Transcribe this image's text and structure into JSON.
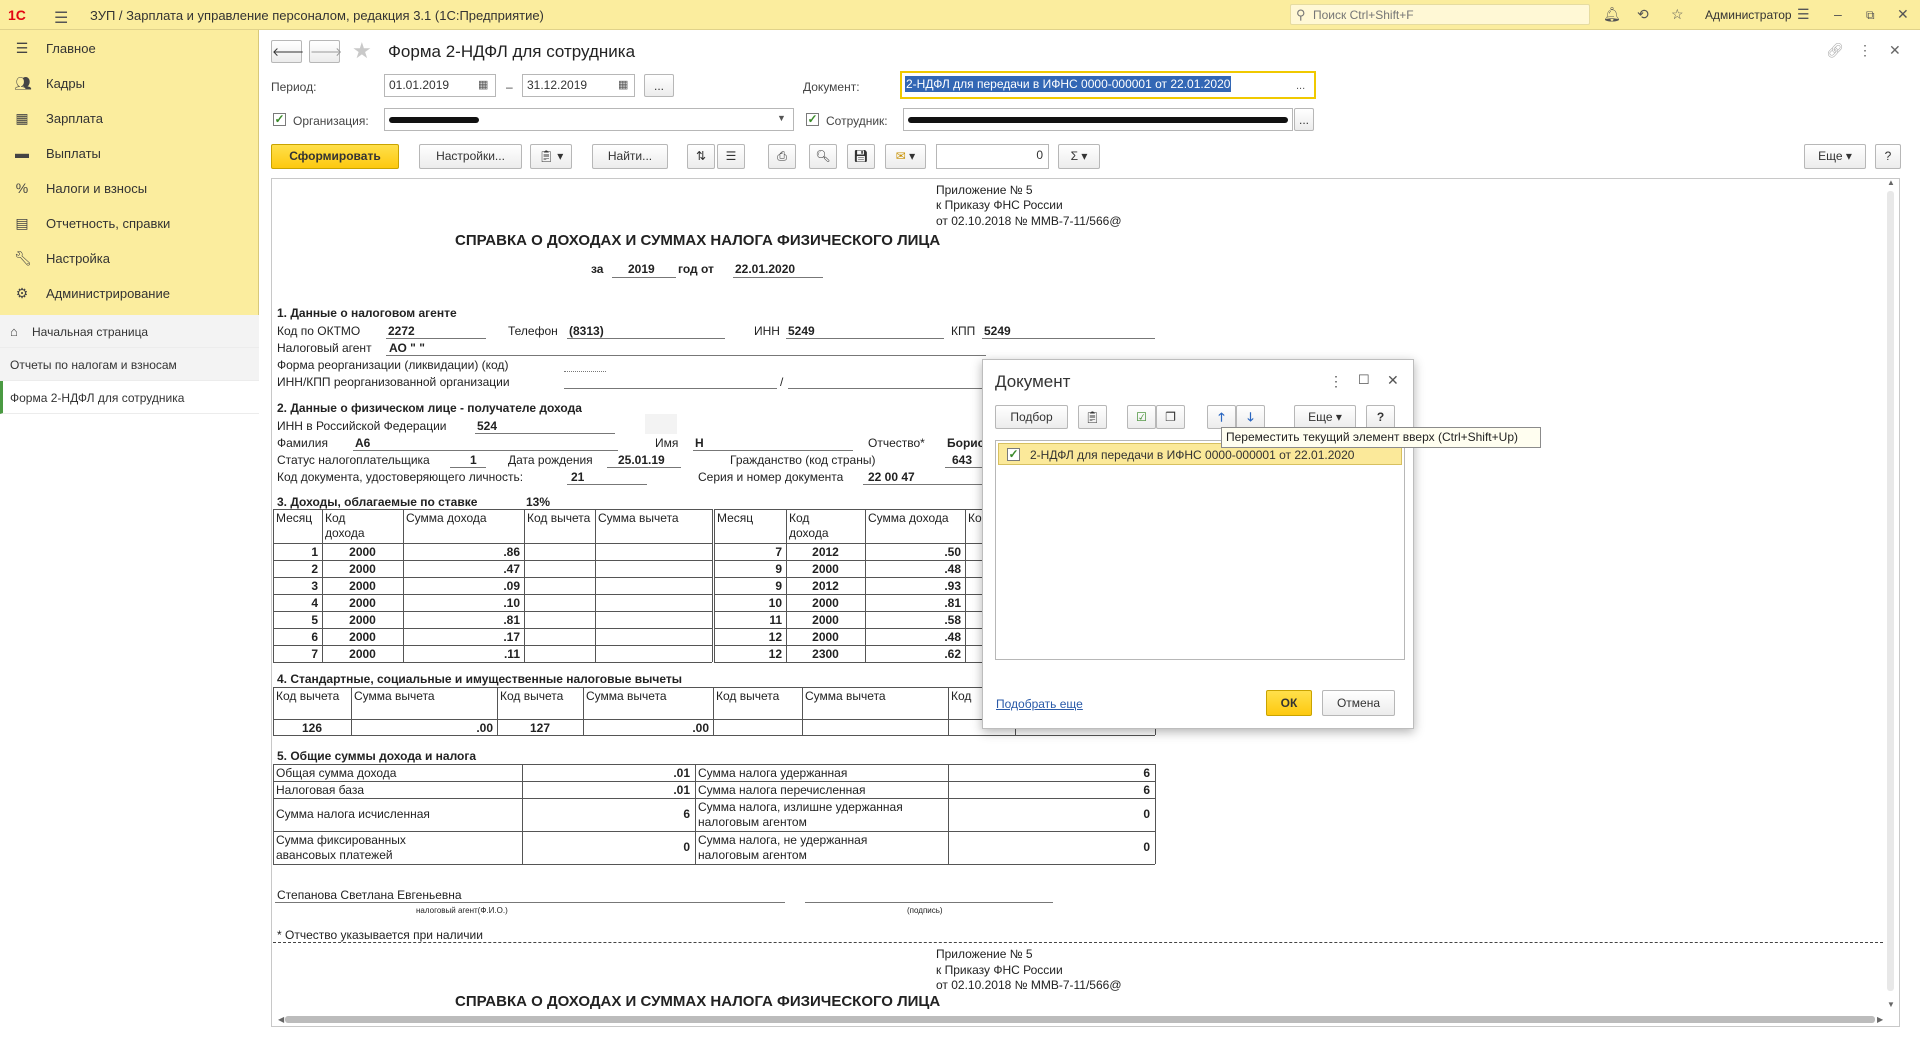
{
  "titlebar": {
    "logo": "1С",
    "app_title": "ЗУП / Зарплата и управление персоналом, редакция 3.1  (1С:Предприятие)",
    "search_placeholder": "Поиск Ctrl+Shift+F",
    "user": "Администратор"
  },
  "sidebar": {
    "items": [
      {
        "icon": "menu-lines-icon",
        "label": "Главное"
      },
      {
        "icon": "people-icon",
        "label": "Кадры"
      },
      {
        "icon": "calculator-icon",
        "label": "Зарплата"
      },
      {
        "icon": "wallet-icon",
        "label": "Выплаты"
      },
      {
        "icon": "percent-icon",
        "label": "Налоги и взносы"
      },
      {
        "icon": "reports-icon",
        "label": "Отчетность, справки"
      },
      {
        "icon": "wrench-icon",
        "label": "Настройка"
      },
      {
        "icon": "gear-icon",
        "label": "Администрирование"
      }
    ],
    "links": [
      {
        "label": "Начальная страница"
      },
      {
        "label": "Отчеты по налогам и взносам"
      },
      {
        "label": "Форма 2-НДФЛ для сотрудника"
      }
    ]
  },
  "form": {
    "title": "Форма 2-НДФЛ для сотрудника",
    "period_label": "Период:",
    "period_from": "01.01.2019",
    "period_dash": "–",
    "period_to": "31.12.2019",
    "ellipsis": "...",
    "document_label": "Документ:",
    "document_value": "2-НДФЛ для передачи в ИФНС 0000-000001 от 22.01.2020",
    "org_label": "Организация:",
    "employee_label": "Сотрудник:",
    "btn_generate": "Сформировать",
    "btn_settings": "Настройки...",
    "btn_find": "Найти...",
    "sum_value": "0",
    "btn_more": "Еще",
    "btn_help": "?"
  },
  "report": {
    "appendix": [
      "Приложение № 5",
      "к Приказу ФНС России",
      "от 02.10.2018 № ММВ-7-11/566@"
    ],
    "title": "СПРАВКА О ДОХОДАХ И СУММАХ НАЛОГА ФИЗИЧЕСКОГО ЛИЦА",
    "for_label": "за",
    "year": "2019",
    "year_from_label": "год от",
    "date": "22.01.2020",
    "s1_title": "1. Данные о налоговом агенте",
    "oktmo_label": "Код по ОКТМО",
    "oktmo": "2272",
    "phone_label": "Телефон",
    "phone": "(8313)",
    "inn_label": "ИНН",
    "inn": "5249",
    "kpp_label": "КПП",
    "kpp": "5249",
    "agent_label": "Налоговый агент",
    "agent": "АО \"                \"",
    "reorg_label": "Форма реорганизации (ликвидации)  (код)",
    "reorg_inn_label": "ИНН/КПП  реорганизованной организации",
    "slash": "/",
    "s2_title": "2. Данные о физическом лице - получателе дохода",
    "inn_rf_label": "ИНН в Российской Федерации",
    "inn_rf": "524",
    "surname_label": "Фамилия",
    "surname": "А6",
    "name_label": "Имя",
    "name": "Н",
    "patronymic_label": "Отчество*",
    "patronymic": "Борис",
    "status_label": "Статус налогоплательщика",
    "status": "1",
    "birth_label": "Дата рождения",
    "birth": "25.01.19",
    "citizenship_label": "Гражданство (код страны)",
    "citizenship": "643",
    "doc_code_label": "Код документа, удостоверяющего личность:",
    "doc_code": "21",
    "doc_series_label": "Серия и номер документа",
    "doc_series": "22 00 47",
    "s3_title": "3. Доходы, облагаемые по ставке",
    "rate": "13%",
    "inc_headers": [
      "Месяц",
      "Код дохода",
      "Сумма дохода",
      "Код вычета",
      "Сумма вычета"
    ],
    "inc_headers_right": [
      "Месяц",
      "Код дохода",
      "Сумма дохода",
      "Ко"
    ],
    "inc_left": [
      [
        "1",
        "2000",
        ".86"
      ],
      [
        "2",
        "2000",
        ".47"
      ],
      [
        "3",
        "2000",
        ".09"
      ],
      [
        "4",
        "2000",
        ".10"
      ],
      [
        "5",
        "2000",
        ".81"
      ],
      [
        "6",
        "2000",
        ".17"
      ],
      [
        "7",
        "2000",
        ".11"
      ]
    ],
    "inc_right": [
      [
        "7",
        "2012",
        ".50"
      ],
      [
        "9",
        "2000",
        ".48"
      ],
      [
        "9",
        "2012",
        ".93"
      ],
      [
        "10",
        "2000",
        ".81"
      ],
      [
        "11",
        "2000",
        ".58"
      ],
      [
        "12",
        "2000",
        ".48"
      ],
      [
        "12",
        "2300",
        ".62"
      ]
    ],
    "s4_title": "4. Стандартные, социальные и имущественные налоговые вычеты",
    "ded_headers": [
      "Код вычета",
      "Сумма вычета",
      "Код вычета",
      "Сумма вычета",
      "Код вычета",
      "Сумма вычета",
      "Код"
    ],
    "ded_row": [
      "126",
      ".00",
      "127",
      ".00"
    ],
    "s5_title": "5. Общие суммы дохода и налога",
    "totals": [
      {
        "l": "Общая сумма дохода",
        "lv": ".01",
        "r": "Сумма налога удержанная",
        "rv": "6"
      },
      {
        "l": "Налоговая база",
        "lv": ".01",
        "r": "Сумма налога перечисленная",
        "rv": "6"
      },
      {
        "l": "Сумма налога исчисленная",
        "lv": "6",
        "r1": "Сумма налога, излишне удержанная",
        "r2": "налоговым агентом",
        "rv": "0"
      },
      {
        "l1": "Сумма фиксированных",
        "l2": "авансовых платежей",
        "lv": "0",
        "r1": "Сумма налога, не удержанная",
        "r2": "налоговым агентом",
        "rv": "0"
      }
    ],
    "signer": "Степанова Светлана Евгеньевна",
    "signer_caption": "налоговый агент(Ф.И.О.)",
    "signature_caption": "(подпись)",
    "footnote": "* Отчество указывается при наличии"
  },
  "dialog": {
    "title": "Документ",
    "btn_pick": "Подбор",
    "btn_more": "Еще",
    "btn_help": "?",
    "item": "2-НДФЛ для передачи в ИФНС 0000-000001 от 22.01.2020",
    "link_pick_more": "Подобрать еще",
    "btn_ok": "ОК",
    "btn_cancel": "Отмена",
    "tooltip": "Переместить текущий элемент вверх (Ctrl+Shift+Up)"
  }
}
